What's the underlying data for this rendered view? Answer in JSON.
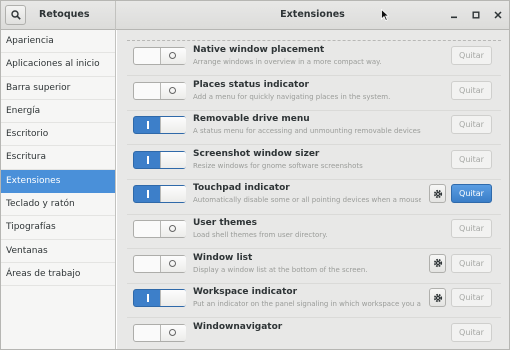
{
  "header": {
    "app_title": "Retoques",
    "page_title": "Extensiones"
  },
  "sidebar": {
    "items": [
      {
        "label": "Apariencia",
        "active": false
      },
      {
        "label": "Aplicaciones al inicio",
        "active": false
      },
      {
        "label": "Barra superior",
        "active": false
      },
      {
        "label": "Energía",
        "active": false
      },
      {
        "label": "Escritorio",
        "active": false
      },
      {
        "label": "Escritura",
        "active": false
      },
      {
        "label": "Extensiones",
        "active": true
      },
      {
        "label": "Teclado y ratón",
        "active": false
      },
      {
        "label": "Tipografías",
        "active": false
      },
      {
        "label": "Ventanas",
        "active": false
      },
      {
        "label": "Áreas de trabajo",
        "active": false
      }
    ]
  },
  "extensions": [
    {
      "name": "Native window placement",
      "description": "Arrange windows in overview in a more compact way.",
      "enabled": false,
      "has_settings": false,
      "remove_label": "Quitar",
      "remove_active": false
    },
    {
      "name": "Places status indicator",
      "description": "Add a menu for quickly navigating places in the system.",
      "enabled": false,
      "has_settings": false,
      "remove_label": "Quitar",
      "remove_active": false
    },
    {
      "name": "Removable drive menu",
      "description": "A status menu for accessing and unmounting removable devices.",
      "enabled": true,
      "has_settings": false,
      "remove_label": "Quitar",
      "remove_active": false
    },
    {
      "name": "Screenshot window sizer",
      "description": "Resize windows for gnome software screenshots",
      "enabled": true,
      "has_settings": false,
      "remove_label": "Quitar",
      "remove_active": false
    },
    {
      "name": "Touchpad indicator",
      "description": "Automatically disable some or all pointing devices when a mouse is plugg...",
      "enabled": true,
      "has_settings": true,
      "remove_label": "Quitar",
      "remove_active": true
    },
    {
      "name": "User themes",
      "description": "Load shell themes from user directory.",
      "enabled": false,
      "has_settings": false,
      "remove_label": "Quitar",
      "remove_active": false
    },
    {
      "name": "Window list",
      "description": "Display a window list at the bottom of the screen.",
      "enabled": false,
      "has_settings": true,
      "remove_label": "Quitar",
      "remove_active": false
    },
    {
      "name": "Workspace indicator",
      "description": "Put an indicator on the panel signaling in which workspace you are, and g...",
      "enabled": true,
      "has_settings": true,
      "remove_label": "Quitar",
      "remove_active": false
    },
    {
      "name": "Windownavigator",
      "description": "",
      "enabled": false,
      "has_settings": false,
      "remove_label": "Quitar",
      "remove_active": false
    }
  ],
  "colors": {
    "accent": "#4a90d9",
    "toggle_on": "#3d7fc9"
  }
}
